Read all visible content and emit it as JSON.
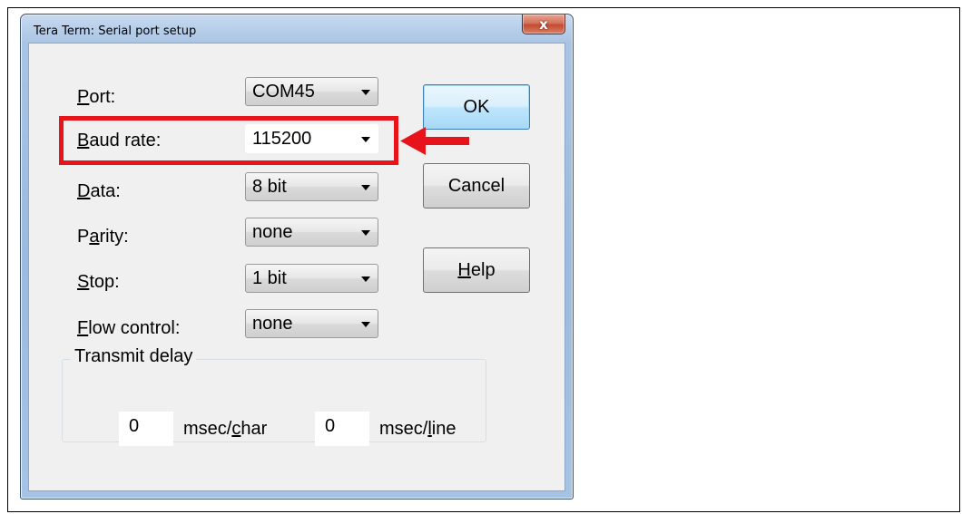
{
  "window": {
    "title": "Tera Term: Serial port setup",
    "close_glyph": "x"
  },
  "fields": [
    {
      "label_ul": "P",
      "label_rest": "ort:",
      "value": "COM45"
    },
    {
      "label_ul": "B",
      "label_rest": "aud rate:",
      "value": "115200"
    },
    {
      "label_ul": "D",
      "label_rest": "ata:",
      "value": "8 bit"
    },
    {
      "label_pre": "P",
      "label_ul": "a",
      "label_rest": "rity:",
      "value": "none"
    },
    {
      "label_ul": "S",
      "label_rest": "top:",
      "value": "1 bit"
    },
    {
      "label_ul": "F",
      "label_rest": "low control:",
      "value": "none"
    }
  ],
  "buttons": {
    "ok": "OK",
    "cancel": "Cancel",
    "help_ul": "H",
    "help_rest": "elp"
  },
  "transmit_delay": {
    "title": "Transmit delay",
    "char_value": "0",
    "char_unit_pre": "msec/",
    "char_unit_ul": "c",
    "char_unit_rest": "har",
    "line_value": "0",
    "line_unit_pre": "msec/",
    "line_unit_ul": "l",
    "line_unit_rest": "ine"
  },
  "annotation": {
    "color": "#e8141c"
  }
}
